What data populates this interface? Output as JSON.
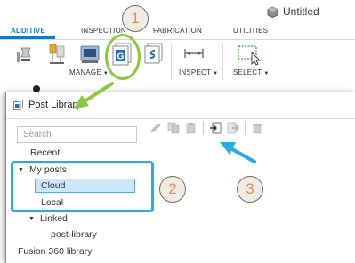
{
  "document": {
    "title": "Untitled"
  },
  "tabs": [
    {
      "label": "ADDITIVE",
      "active": true
    },
    {
      "label": "INSPECTION",
      "active": false
    },
    {
      "label": "FABRICATION",
      "active": false
    },
    {
      "label": "UTILITIES",
      "active": false
    }
  ],
  "groups": {
    "manage": "MANAGE",
    "inspect": "INSPECT",
    "select": "SELECT"
  },
  "callouts": [
    "1",
    "2",
    "3"
  ],
  "dialog": {
    "title": "Post Library",
    "search_placeholder": "Search",
    "tree": {
      "recent": "Recent",
      "my_posts": "My posts",
      "cloud": "Cloud",
      "local": "Local",
      "linked": "Linked",
      "post_library": "post-library",
      "fusion_library": "Fusion 360 library"
    }
  },
  "colors": {
    "accent_blue": "#1a78c2",
    "highlight_green": "#8dc63f",
    "highlight_blue": "#29abe2",
    "callout_number": "#e08d56",
    "selection_fill": "#cfe6f8"
  },
  "icons": {
    "toolbar": [
      "arrange-icon",
      "supports-icon",
      "machine-icon",
      "post-library-icon",
      "templates-icon",
      "measure-icon",
      "window-select-icon"
    ],
    "dialog_toolbar": [
      "edit-icon",
      "duplicate-icon",
      "paste-icon",
      "import-icon",
      "export-icon",
      "delete-icon"
    ]
  }
}
